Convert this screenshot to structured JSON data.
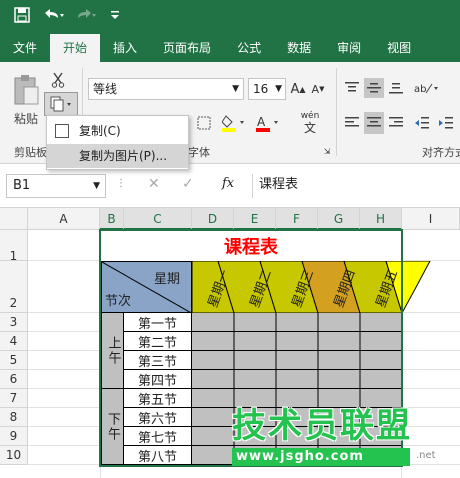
{
  "qat": {
    "save_icon": "save-icon",
    "undo_icon": "undo-icon",
    "redo_icon": "redo-icon",
    "customize_icon": "customize-icon"
  },
  "tabs": [
    {
      "label": "文件",
      "active": false
    },
    {
      "label": "开始",
      "active": true
    },
    {
      "label": "插入",
      "active": false
    },
    {
      "label": "页面布局",
      "active": false
    },
    {
      "label": "公式",
      "active": false
    },
    {
      "label": "数据",
      "active": false
    },
    {
      "label": "审阅",
      "active": false
    },
    {
      "label": "视图",
      "active": false
    }
  ],
  "ribbon": {
    "paste_label": "粘贴",
    "clipboard_group": "剪贴板",
    "font_name": "等线",
    "font_size": "16",
    "font_group": "字体",
    "align_group": "对齐方式",
    "wen_label": "wén",
    "wen_char": "文"
  },
  "popup": {
    "copy": "复制(C)",
    "copy_as_picture": "复制为图片(P)..."
  },
  "formula_bar": {
    "name_box": "B1",
    "fx": "fx",
    "value": "课程表"
  },
  "grid": {
    "columns": [
      "A",
      "B",
      "C",
      "D",
      "E",
      "F",
      "G",
      "H",
      "I"
    ],
    "rows": [
      "1",
      "2",
      "3",
      "4",
      "5",
      "6",
      "7",
      "8",
      "9",
      "10"
    ],
    "title": "课程表",
    "header_xingqi": "星期",
    "header_jieci": "节次",
    "days": [
      "星期一",
      "星期二",
      "星期三",
      "星期四",
      "星期五"
    ],
    "morning": "上午",
    "afternoon": "下午",
    "periods": [
      "第一节",
      "第二节",
      "第三节",
      "第四节",
      "第五节",
      "第六节",
      "第七节",
      "第八节"
    ]
  },
  "watermark": {
    "text": "技术员联盟",
    "url": "www.jsgho.com",
    "suffix": ".net"
  },
  "colors": {
    "brand": "#217346",
    "title_red": "#ff0000",
    "day_yellow": "#c8c800",
    "day_orange": "#d4a020",
    "header_blue": "#8aa4c8"
  }
}
